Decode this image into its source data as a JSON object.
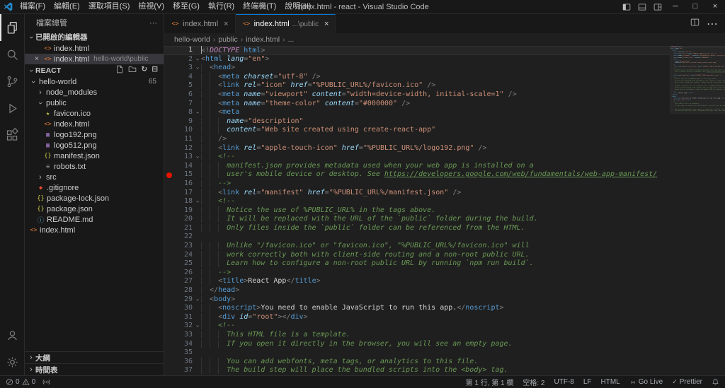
{
  "window": {
    "title": "index.html - react - Visual Studio Code",
    "menus": [
      "檔案(F)",
      "編輯(E)",
      "選取項目(S)",
      "檢視(V)",
      "移至(G)",
      "執行(R)",
      "終端機(T)",
      "說明(H)"
    ]
  },
  "sidebar": {
    "title": "檔案總管",
    "open_editors": {
      "label": "已開啟的編輯器",
      "items": [
        {
          "label": "index.html",
          "detail": "",
          "active": false
        },
        {
          "label": "index.html",
          "detail": "hello-world\\public",
          "active": true
        }
      ]
    },
    "project": {
      "label": "REACT",
      "tree": [
        {
          "label": "hello-world",
          "type": "folder",
          "expanded": true,
          "level": 0,
          "badge": "65"
        },
        {
          "label": "node_modules",
          "type": "folder",
          "expanded": false,
          "level": 1
        },
        {
          "label": "public",
          "type": "folder",
          "expanded": true,
          "level": 1
        },
        {
          "label": "favicon.ico",
          "icon": "star",
          "level": 2
        },
        {
          "label": "index.html",
          "icon": "html",
          "level": 2
        },
        {
          "label": "logo192.png",
          "icon": "image",
          "level": 2
        },
        {
          "label": "logo512.png",
          "icon": "image",
          "level": 2
        },
        {
          "label": "manifest.json",
          "icon": "json",
          "level": 2
        },
        {
          "label": "robots.txt",
          "icon": "text",
          "level": 2
        },
        {
          "label": "src",
          "type": "folder",
          "expanded": false,
          "level": 1
        },
        {
          "label": ".gitignore",
          "icon": "git",
          "level": 1
        },
        {
          "label": "package-lock.json",
          "icon": "json",
          "level": 1
        },
        {
          "label": "package.json",
          "icon": "json",
          "level": 1
        },
        {
          "label": "README.md",
          "icon": "info",
          "level": 1
        },
        {
          "label": "index.html",
          "icon": "html",
          "level": 0
        }
      ]
    },
    "sections": [
      "大綱",
      "時間表"
    ]
  },
  "tabs": [
    {
      "label": "index.html",
      "detail": "",
      "active": false
    },
    {
      "label": "index.html",
      "detail": "...\\public",
      "active": true
    }
  ],
  "breadcrumb": [
    "hello-world",
    "public",
    "index.html",
    "..."
  ],
  "editor": {
    "current_line": 1,
    "breakpoint_line": 15,
    "lines": [
      {
        "i": 0,
        "t": [
          [
            "p",
            "<!"
          ],
          [
            "k",
            "DOCTYPE"
          ],
          [
            "x",
            " "
          ],
          [
            "t",
            "html"
          ],
          [
            "p",
            ">"
          ]
        ]
      },
      {
        "i": 0,
        "f": true,
        "t": [
          [
            "p",
            "<"
          ],
          [
            "t",
            "html"
          ],
          [
            "x",
            " "
          ],
          [
            "a",
            "lang"
          ],
          [
            "p",
            "="
          ],
          [
            "s",
            "\"en\""
          ],
          [
            "p",
            ">"
          ]
        ]
      },
      {
        "i": 2,
        "f": true,
        "t": [
          [
            "p",
            "<"
          ],
          [
            "t",
            "head"
          ],
          [
            "p",
            ">"
          ]
        ]
      },
      {
        "i": 4,
        "t": [
          [
            "p",
            "<"
          ],
          [
            "t",
            "meta"
          ],
          [
            "x",
            " "
          ],
          [
            "a",
            "charset"
          ],
          [
            "p",
            "="
          ],
          [
            "s",
            "\"utf-8\""
          ],
          [
            "x",
            " "
          ],
          [
            "p",
            "/>"
          ]
        ]
      },
      {
        "i": 4,
        "t": [
          [
            "p",
            "<"
          ],
          [
            "t",
            "link"
          ],
          [
            "x",
            " "
          ],
          [
            "a",
            "rel"
          ],
          [
            "p",
            "="
          ],
          [
            "s",
            "\"icon\""
          ],
          [
            "x",
            " "
          ],
          [
            "a",
            "href"
          ],
          [
            "p",
            "="
          ],
          [
            "s",
            "\"%PUBLIC_URL%/favicon.ico\""
          ],
          [
            "x",
            " "
          ],
          [
            "p",
            "/>"
          ]
        ]
      },
      {
        "i": 4,
        "t": [
          [
            "p",
            "<"
          ],
          [
            "t",
            "meta"
          ],
          [
            "x",
            " "
          ],
          [
            "a",
            "name"
          ],
          [
            "p",
            "="
          ],
          [
            "s",
            "\"viewport\""
          ],
          [
            "x",
            " "
          ],
          [
            "a",
            "content"
          ],
          [
            "p",
            "="
          ],
          [
            "s",
            "\"width=device-width, initial-scale=1\""
          ],
          [
            "x",
            " "
          ],
          [
            "p",
            "/>"
          ]
        ]
      },
      {
        "i": 4,
        "t": [
          [
            "p",
            "<"
          ],
          [
            "t",
            "meta"
          ],
          [
            "x",
            " "
          ],
          [
            "a",
            "name"
          ],
          [
            "p",
            "="
          ],
          [
            "s",
            "\"theme-color\""
          ],
          [
            "x",
            " "
          ],
          [
            "a",
            "content"
          ],
          [
            "p",
            "="
          ],
          [
            "s",
            "\"#000000\""
          ],
          [
            "x",
            " "
          ],
          [
            "p",
            "/>"
          ]
        ]
      },
      {
        "i": 4,
        "f": true,
        "t": [
          [
            "p",
            "<"
          ],
          [
            "t",
            "meta"
          ]
        ]
      },
      {
        "i": 6,
        "t": [
          [
            "a",
            "name"
          ],
          [
            "p",
            "="
          ],
          [
            "s",
            "\"description\""
          ]
        ]
      },
      {
        "i": 6,
        "t": [
          [
            "a",
            "content"
          ],
          [
            "p",
            "="
          ],
          [
            "s",
            "\"Web site created using create-react-app\""
          ]
        ]
      },
      {
        "i": 4,
        "t": [
          [
            "p",
            "/>"
          ]
        ]
      },
      {
        "i": 4,
        "t": [
          [
            "p",
            "<"
          ],
          [
            "t",
            "link"
          ],
          [
            "x",
            " "
          ],
          [
            "a",
            "rel"
          ],
          [
            "p",
            "="
          ],
          [
            "s",
            "\"apple-touch-icon\""
          ],
          [
            "x",
            " "
          ],
          [
            "a",
            "href"
          ],
          [
            "p",
            "="
          ],
          [
            "s",
            "\"%PUBLIC_URL%/logo192.png\""
          ],
          [
            "x",
            " "
          ],
          [
            "p",
            "/>"
          ]
        ]
      },
      {
        "i": 4,
        "f": true,
        "t": [
          [
            "c",
            "<!--"
          ]
        ]
      },
      {
        "i": 6,
        "t": [
          [
            "c",
            "manifest.json provides metadata used when your web app is installed on a"
          ]
        ]
      },
      {
        "i": 6,
        "t": [
          [
            "c",
            "user's mobile device or desktop. See "
          ],
          [
            "u",
            "https://developers.google.com/web/fundamentals/web-app-manifest/"
          ]
        ]
      },
      {
        "i": 4,
        "t": [
          [
            "c",
            "-->"
          ]
        ]
      },
      {
        "i": 4,
        "t": [
          [
            "p",
            "<"
          ],
          [
            "t",
            "link"
          ],
          [
            "x",
            " "
          ],
          [
            "a",
            "rel"
          ],
          [
            "p",
            "="
          ],
          [
            "s",
            "\"manifest\""
          ],
          [
            "x",
            " "
          ],
          [
            "a",
            "href"
          ],
          [
            "p",
            "="
          ],
          [
            "s",
            "\"%PUBLIC_URL%/manifest.json\""
          ],
          [
            "x",
            " "
          ],
          [
            "p",
            "/>"
          ]
        ]
      },
      {
        "i": 4,
        "f": true,
        "t": [
          [
            "c",
            "<!--"
          ]
        ]
      },
      {
        "i": 6,
        "t": [
          [
            "c",
            "Notice the use of %PUBLIC_URL% in the tags above."
          ]
        ]
      },
      {
        "i": 6,
        "t": [
          [
            "c",
            "It will be replaced with the URL of the `public` folder during the build."
          ]
        ]
      },
      {
        "i": 6,
        "t": [
          [
            "c",
            "Only files inside the `public` folder can be referenced from the HTML."
          ]
        ]
      },
      {
        "i": 0,
        "t": []
      },
      {
        "i": 6,
        "t": [
          [
            "c",
            "Unlike \"/favicon.ico\" or \"favicon.ico\", \"%PUBLIC_URL%/favicon.ico\" will"
          ]
        ]
      },
      {
        "i": 6,
        "t": [
          [
            "c",
            "work correctly both with client-side routing and a non-root public URL."
          ]
        ]
      },
      {
        "i": 6,
        "t": [
          [
            "c",
            "Learn how to configure a non-root public URL by running `npm run build`."
          ]
        ]
      },
      {
        "i": 4,
        "t": [
          [
            "c",
            "-->"
          ]
        ]
      },
      {
        "i": 4,
        "t": [
          [
            "p",
            "<"
          ],
          [
            "t",
            "title"
          ],
          [
            "p",
            ">"
          ],
          [
            "x",
            "React App"
          ],
          [
            "p",
            "</"
          ],
          [
            "t",
            "title"
          ],
          [
            "p",
            ">"
          ]
        ]
      },
      {
        "i": 2,
        "t": [
          [
            "p",
            "</"
          ],
          [
            "t",
            "head"
          ],
          [
            "p",
            ">"
          ]
        ]
      },
      {
        "i": 2,
        "f": true,
        "t": [
          [
            "p",
            "<"
          ],
          [
            "t",
            "body"
          ],
          [
            "p",
            ">"
          ]
        ]
      },
      {
        "i": 4,
        "t": [
          [
            "p",
            "<"
          ],
          [
            "t",
            "noscript"
          ],
          [
            "p",
            ">"
          ],
          [
            "x",
            "You need to enable JavaScript to run this app."
          ],
          [
            "p",
            "</"
          ],
          [
            "t",
            "noscript"
          ],
          [
            "p",
            ">"
          ]
        ]
      },
      {
        "i": 4,
        "t": [
          [
            "p",
            "<"
          ],
          [
            "t",
            "div"
          ],
          [
            "x",
            " "
          ],
          [
            "a",
            "id"
          ],
          [
            "p",
            "="
          ],
          [
            "s",
            "\"root\""
          ],
          [
            "p",
            ">"
          ],
          [
            "p",
            "</"
          ],
          [
            "t",
            "div"
          ],
          [
            "p",
            ">"
          ]
        ]
      },
      {
        "i": 4,
        "f": true,
        "t": [
          [
            "c",
            "<!--"
          ]
        ]
      },
      {
        "i": 6,
        "t": [
          [
            "c",
            "This HTML file is a template."
          ]
        ]
      },
      {
        "i": 6,
        "t": [
          [
            "c",
            "If you open it directly in the browser, you will see an empty page."
          ]
        ]
      },
      {
        "i": 0,
        "t": []
      },
      {
        "i": 6,
        "t": [
          [
            "c",
            "You can add webfonts, meta tags, or analytics to this file."
          ]
        ]
      },
      {
        "i": 6,
        "t": [
          [
            "c",
            "The build step will place the bundled scripts into the <body> tag."
          ]
        ]
      }
    ]
  },
  "status_bar": {
    "errors": "0",
    "warnings": "0",
    "cursor_position": "第 1 行, 第 1 欄",
    "indentation": "空格: 2",
    "encoding": "UTF-8",
    "eol": "LF",
    "language": "HTML",
    "go_live": "Go Live",
    "prettier": "Prettier"
  }
}
